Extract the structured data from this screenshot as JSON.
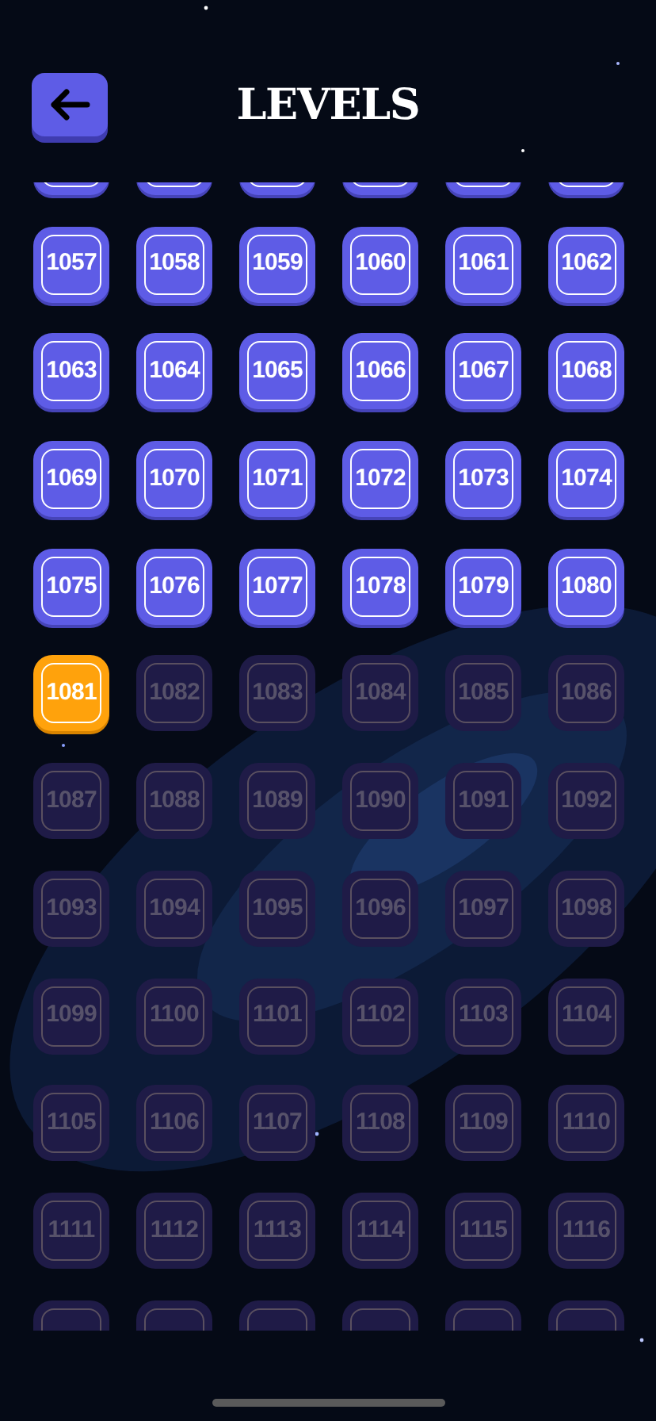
{
  "title": "LEVELS",
  "clipped_rows": [
    {
      "locked": false
    },
    {
      "locked": true
    }
  ],
  "levels": [
    {
      "label": "1057",
      "locked": false,
      "current": false
    },
    {
      "label": "1058",
      "locked": false,
      "current": false
    },
    {
      "label": "1059",
      "locked": false,
      "current": false
    },
    {
      "label": "1060",
      "locked": false,
      "current": false
    },
    {
      "label": "1061",
      "locked": false,
      "current": false
    },
    {
      "label": "1062",
      "locked": false,
      "current": false
    },
    {
      "label": "1063",
      "locked": false,
      "current": false
    },
    {
      "label": "1064",
      "locked": false,
      "current": false
    },
    {
      "label": "1065",
      "locked": false,
      "current": false
    },
    {
      "label": "1066",
      "locked": false,
      "current": false
    },
    {
      "label": "1067",
      "locked": false,
      "current": false
    },
    {
      "label": "1068",
      "locked": false,
      "current": false
    },
    {
      "label": "1069",
      "locked": false,
      "current": false
    },
    {
      "label": "1070",
      "locked": false,
      "current": false
    },
    {
      "label": "1071",
      "locked": false,
      "current": false
    },
    {
      "label": "1072",
      "locked": false,
      "current": false
    },
    {
      "label": "1073",
      "locked": false,
      "current": false
    },
    {
      "label": "1074",
      "locked": false,
      "current": false
    },
    {
      "label": "1075",
      "locked": false,
      "current": false
    },
    {
      "label": "1076",
      "locked": false,
      "current": false
    },
    {
      "label": "1077",
      "locked": false,
      "current": false
    },
    {
      "label": "1078",
      "locked": false,
      "current": false
    },
    {
      "label": "1079",
      "locked": false,
      "current": false
    },
    {
      "label": "1080",
      "locked": false,
      "current": false
    },
    {
      "label": "1081",
      "locked": false,
      "current": true
    },
    {
      "label": "1082",
      "locked": true,
      "current": false
    },
    {
      "label": "1083",
      "locked": true,
      "current": false
    },
    {
      "label": "1084",
      "locked": true,
      "current": false
    },
    {
      "label": "1085",
      "locked": true,
      "current": false
    },
    {
      "label": "1086",
      "locked": true,
      "current": false
    },
    {
      "label": "1087",
      "locked": true,
      "current": false
    },
    {
      "label": "1088",
      "locked": true,
      "current": false
    },
    {
      "label": "1089",
      "locked": true,
      "current": false
    },
    {
      "label": "1090",
      "locked": true,
      "current": false
    },
    {
      "label": "1091",
      "locked": true,
      "current": false
    },
    {
      "label": "1092",
      "locked": true,
      "current": false
    },
    {
      "label": "1093",
      "locked": true,
      "current": false
    },
    {
      "label": "1094",
      "locked": true,
      "current": false
    },
    {
      "label": "1095",
      "locked": true,
      "current": false
    },
    {
      "label": "1096",
      "locked": true,
      "current": false
    },
    {
      "label": "1097",
      "locked": true,
      "current": false
    },
    {
      "label": "1098",
      "locked": true,
      "current": false
    },
    {
      "label": "1099",
      "locked": true,
      "current": false
    },
    {
      "label": "1100",
      "locked": true,
      "current": false
    },
    {
      "label": "1101",
      "locked": true,
      "current": false
    },
    {
      "label": "1102",
      "locked": true,
      "current": false
    },
    {
      "label": "1103",
      "locked": true,
      "current": false
    },
    {
      "label": "1104",
      "locked": true,
      "current": false
    },
    {
      "label": "1105",
      "locked": true,
      "current": false
    },
    {
      "label": "1106",
      "locked": true,
      "current": false
    },
    {
      "label": "1107",
      "locked": true,
      "current": false
    },
    {
      "label": "1108",
      "locked": true,
      "current": false
    },
    {
      "label": "1109",
      "locked": true,
      "current": false
    },
    {
      "label": "1110",
      "locked": true,
      "current": false
    },
    {
      "label": "1111",
      "locked": true,
      "current": false
    },
    {
      "label": "1112",
      "locked": true,
      "current": false
    },
    {
      "label": "1113",
      "locked": true,
      "current": false
    },
    {
      "label": "1114",
      "locked": true,
      "current": false
    },
    {
      "label": "1115",
      "locked": true,
      "current": false
    },
    {
      "label": "1116",
      "locked": true,
      "current": false
    }
  ]
}
